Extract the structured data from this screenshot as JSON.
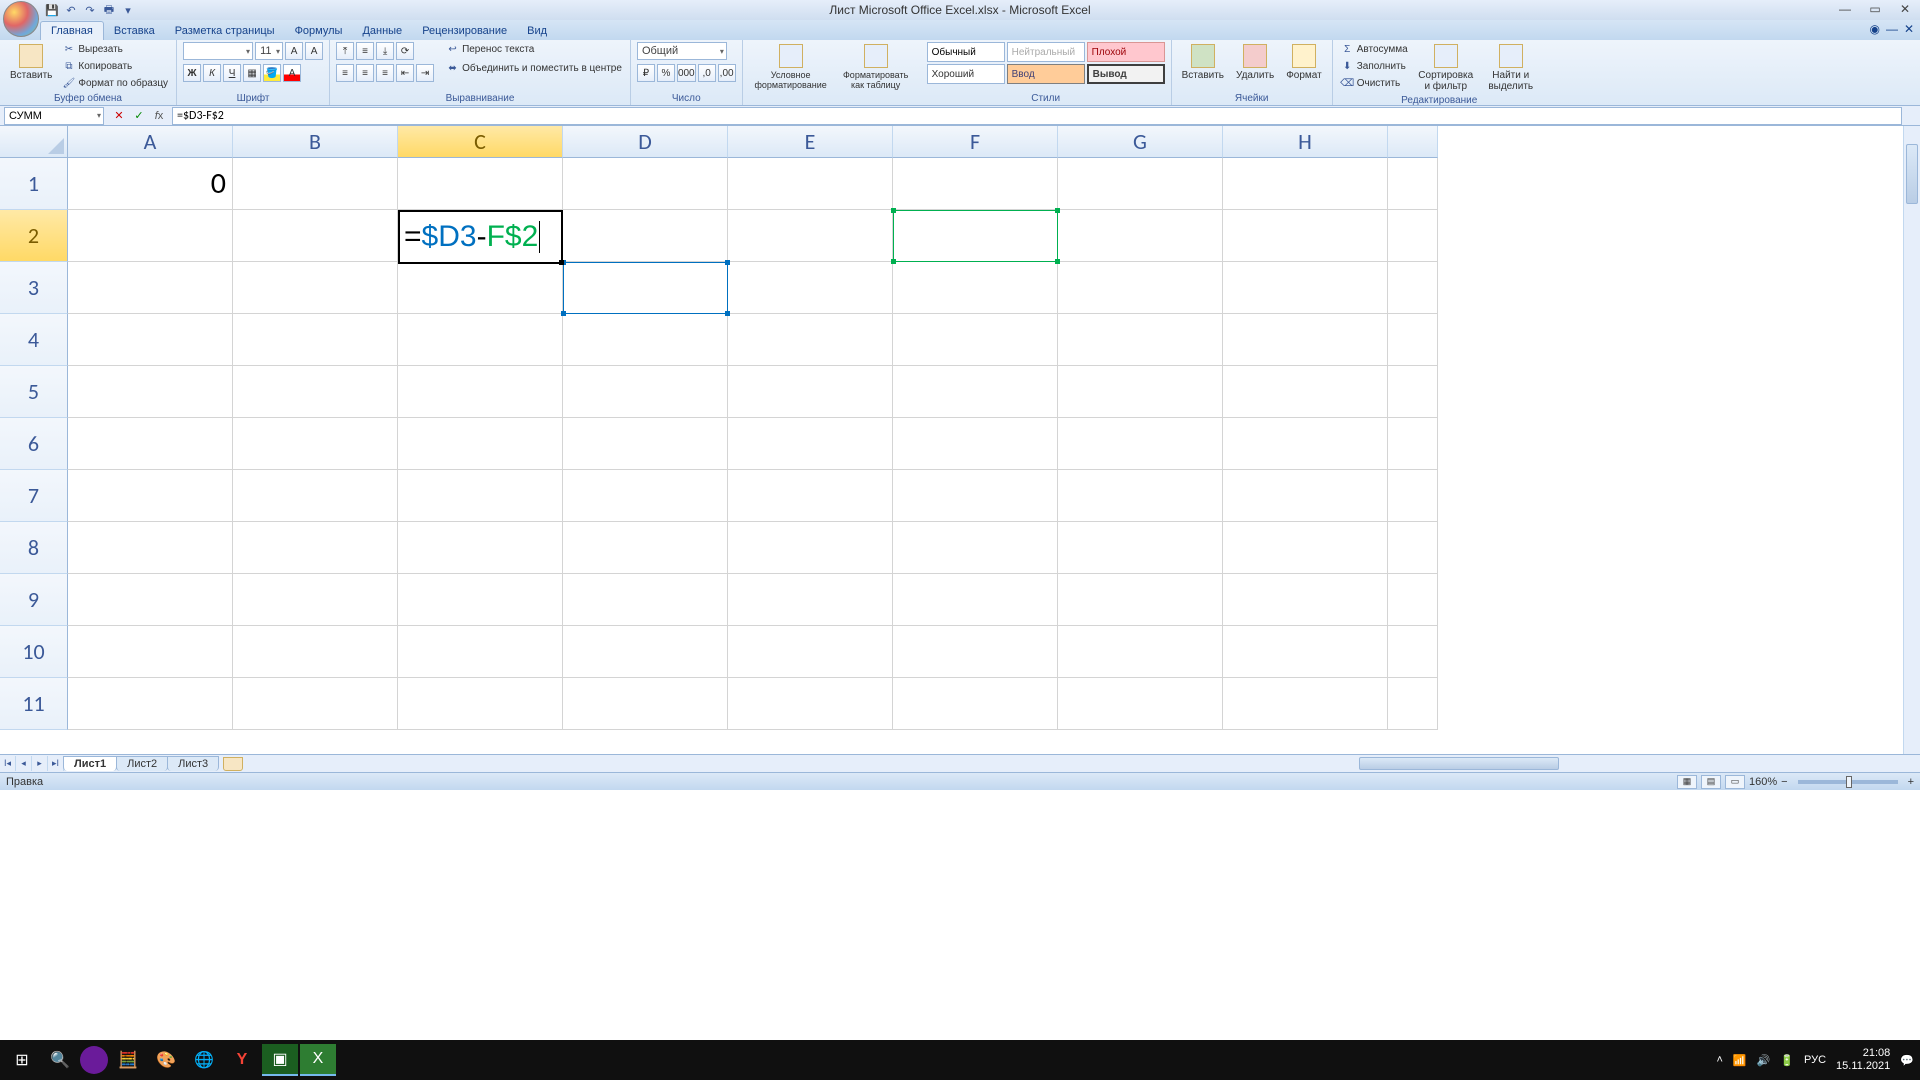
{
  "title": "Лист Microsoft Office Excel.xlsx - Microsoft Excel",
  "tabs": {
    "home": "Главная",
    "insert": "Вставка",
    "layout": "Разметка страницы",
    "formulas": "Формулы",
    "data": "Данные",
    "review": "Рецензирование",
    "view": "Вид"
  },
  "ribbon": {
    "clipboard": {
      "label": "Буфер обмена",
      "paste": "Вставить",
      "cut": "Вырезать",
      "copy": "Копировать",
      "format": "Формат по образцу"
    },
    "font": {
      "label": "Шрифт",
      "size": "11"
    },
    "align": {
      "label": "Выравнивание",
      "wrap": "Перенос текста",
      "merge": "Объединить и поместить в центре"
    },
    "number": {
      "label": "Число",
      "format": "Общий"
    },
    "cond": {
      "label": "Условное форматирование"
    },
    "table": {
      "label": "Форматировать как таблицу"
    },
    "styles": {
      "label": "Стили",
      "normal": "Обычный",
      "neutral": "Нейтральный",
      "bad": "Плохой",
      "good": "Хороший",
      "input": "Ввод",
      "output": "Вывод"
    },
    "cells": {
      "label": "Ячейки",
      "insert": "Вставить",
      "delete": "Удалить",
      "format": "Формат"
    },
    "editing": {
      "label": "Редактирование",
      "sum": "Автосумма",
      "fill": "Заполнить",
      "clear": "Очистить",
      "sort": "Сортировка и фильтр",
      "find": "Найти и выделить"
    }
  },
  "namebox": "СУММ",
  "formula": "=$D3-F$2",
  "formula_parts": {
    "eq": "=",
    "ref1": "$D3",
    "op": "-",
    "ref2": "F$2"
  },
  "columns": [
    "A",
    "B",
    "C",
    "D",
    "E",
    "F",
    "G",
    "H"
  ],
  "rows": [
    "1",
    "2",
    "3",
    "4",
    "5",
    "6",
    "7",
    "8",
    "9",
    "10",
    "11"
  ],
  "active_col": "C",
  "active_row": "2",
  "cell_a1": "0",
  "sheets": {
    "s1": "Лист1",
    "s2": "Лист2",
    "s3": "Лист3"
  },
  "status": "Правка",
  "zoom": "160%",
  "clock": {
    "time": "21:08",
    "date": "15.11.2021"
  },
  "lang": "РУС"
}
